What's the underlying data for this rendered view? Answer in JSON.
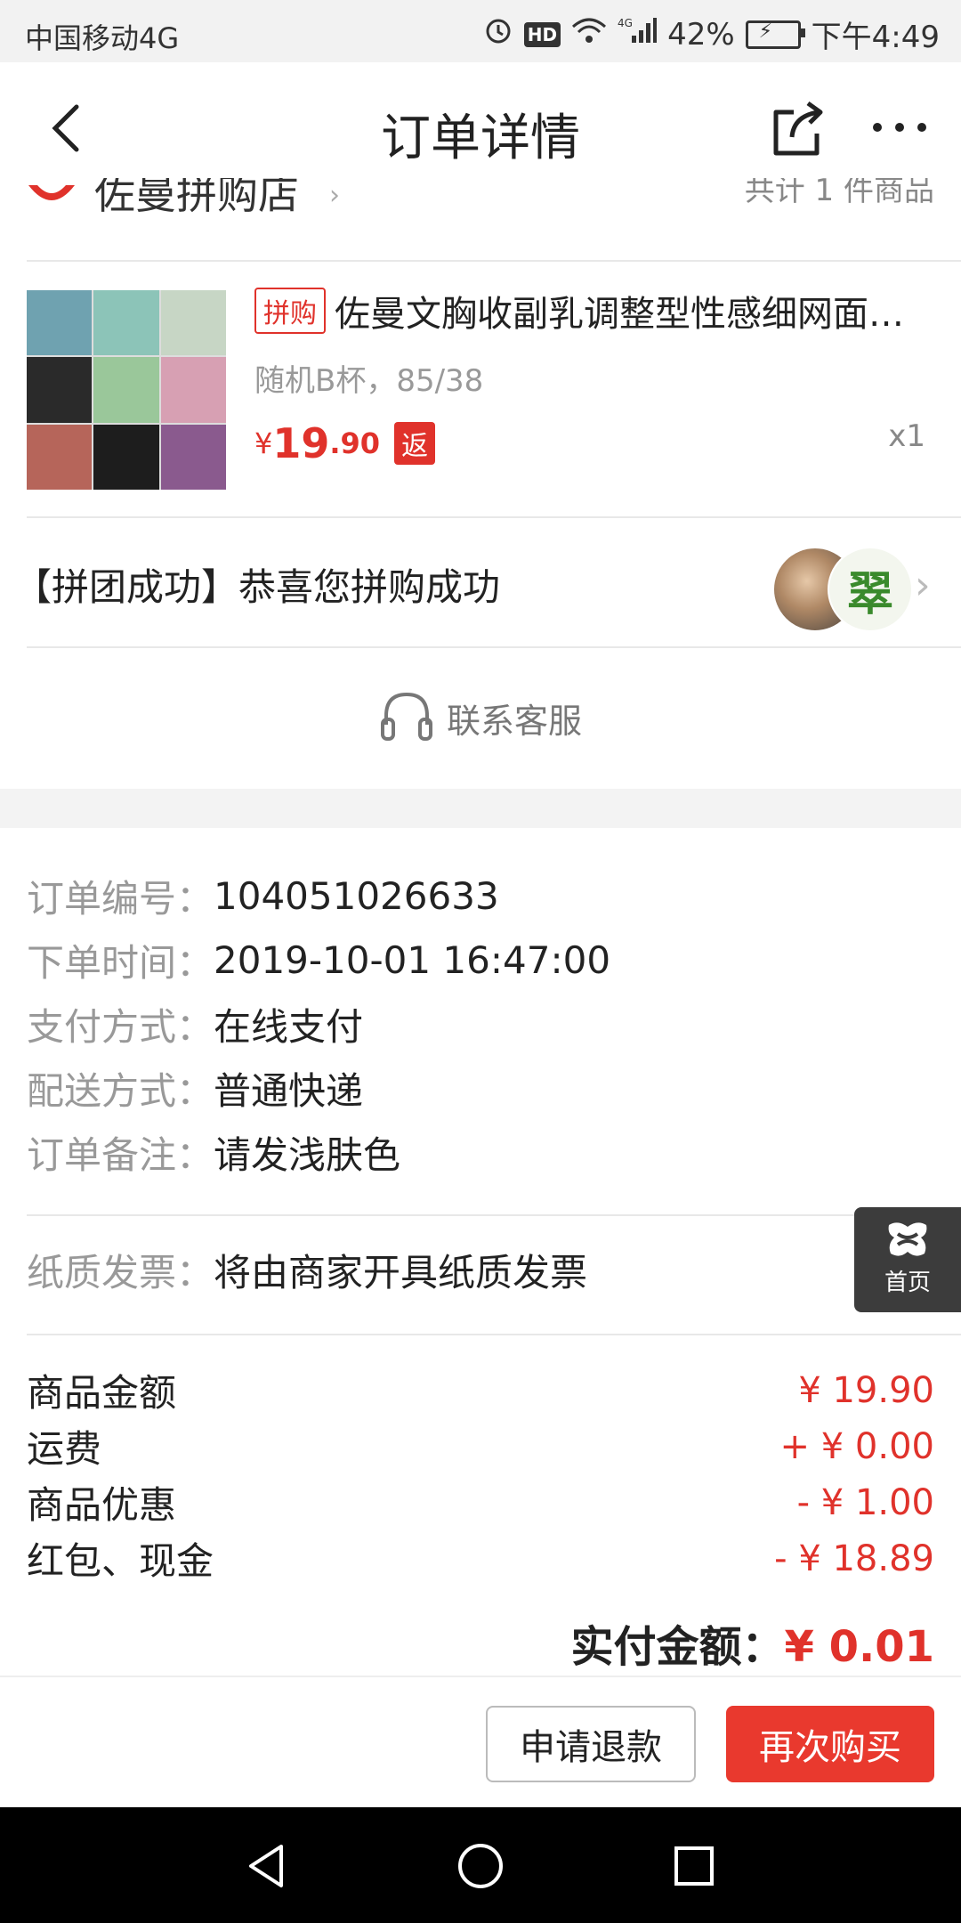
{
  "status_bar": {
    "carrier": "中国移动4G",
    "hd": "HD",
    "network": "4G",
    "battery": "42%",
    "time": "下午4:49"
  },
  "header": {
    "title": "订单详情"
  },
  "store": {
    "name": "佐曼拼购店",
    "count": "共计 1 件商品"
  },
  "product": {
    "badge": "拼购",
    "name": "佐曼文胸收副乳调整型性感细网面…",
    "sku": "随机B杯，85/38",
    "price_symbol": "¥",
    "price_int": "19",
    "price_dec": ".90",
    "rebate_badge": "返",
    "qty": "x1"
  },
  "group": {
    "text": "【拼团成功】恭喜您拼购成功",
    "avatar2_char": "翠"
  },
  "contact": {
    "label": "联系客服"
  },
  "order_info": [
    {
      "key": "订单编号：",
      "value": "104051026633"
    },
    {
      "key": "下单时间：",
      "value": "2019-10-01 16:47:00"
    },
    {
      "key": "支付方式：",
      "value": "在线支付"
    },
    {
      "key": "配送方式：",
      "value": "普通快递"
    },
    {
      "key": "订单备注：",
      "value": "请发浅肤色"
    }
  ],
  "invoice": {
    "key": "纸质发票：",
    "value": "将由商家开具纸质发票"
  },
  "home_float": {
    "label": "首页"
  },
  "amounts": [
    {
      "key": "商品金额",
      "value": "¥ 19.90"
    },
    {
      "key": "运费",
      "value": "+ ¥ 0.00"
    },
    {
      "key": "商品优惠",
      "value": "- ¥ 1.00"
    },
    {
      "key": "红包、现金",
      "value": "- ¥ 18.89"
    }
  ],
  "paid": {
    "key": "实付金额：",
    "value": "¥ 0.01"
  },
  "actions": {
    "refund": "申请退款",
    "rebuy": "再次购买"
  },
  "colors": {
    "accent_red": "#e0322b",
    "buy_button": "#e9392e"
  }
}
